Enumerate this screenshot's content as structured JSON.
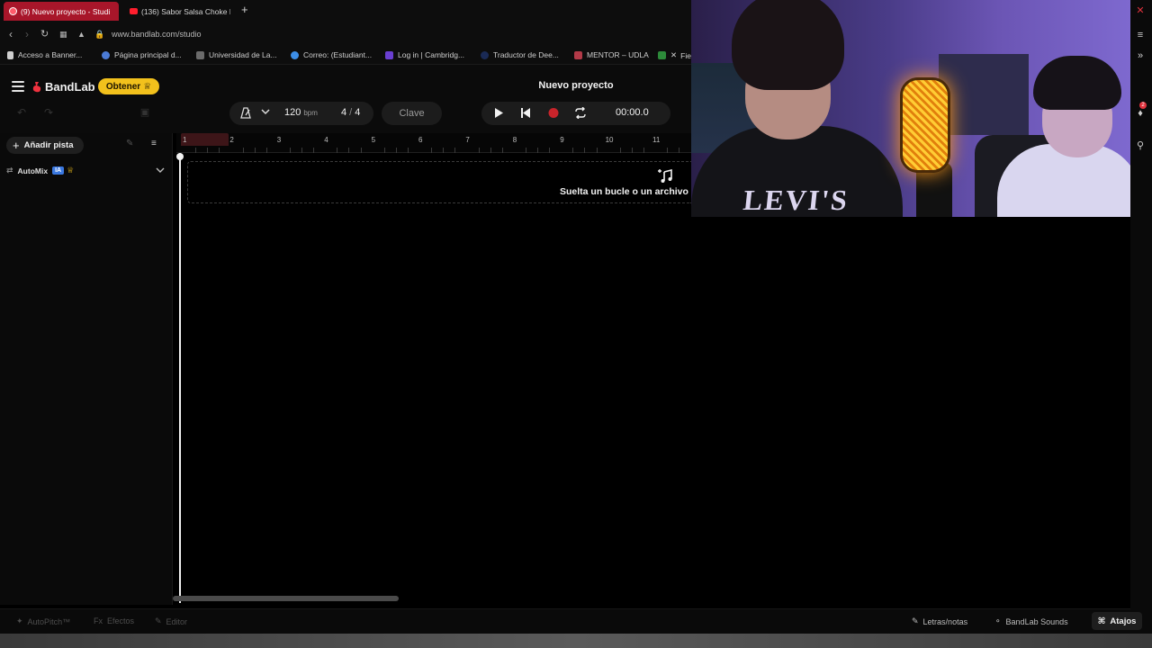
{
  "browser": {
    "tabs": [
      {
        "label": "(9) Nuevo proyecto - Studi",
        "active": true
      },
      {
        "label": "(136) Sabor Salsa Choke I",
        "active": false
      }
    ],
    "new_tab": "+",
    "url": "www.bandlab.com/studio",
    "bookmarks": [
      {
        "label": "Acceso a Banner...",
        "color": "#cfcfcf"
      },
      {
        "label": "Página principal d...",
        "color": "#4b7bd6"
      },
      {
        "label": "Universidad de La...",
        "color": "#6b6b6b"
      },
      {
        "label": "Correo: (Estudiant...",
        "color": "#3c8ee8"
      },
      {
        "label": "Log in | Cambridg...",
        "color": "#6a3fd1"
      },
      {
        "label": "Traductor de Dee...",
        "color": "#1a2a55"
      },
      {
        "label": "MENTOR – UDLA",
        "color": "#b23a48"
      },
      {
        "label": "Fie",
        "color": "#2d8a3a"
      }
    ]
  },
  "app": {
    "brand": "BandLab",
    "obtener_label": "Obtener",
    "project_title": "Nuevo proyecto",
    "tempo_value": "120",
    "tempo_unit": "bpm",
    "sig_num": "4",
    "sig_sep": "/",
    "sig_den": "4",
    "key_label": "Clave",
    "time": "00:00.0",
    "accent": "#f2c11c",
    "record_color": "#c8242b"
  },
  "sidebar": {
    "add_track": "Añadir pista",
    "automix": "AutoMix",
    "ia_badge": "IA"
  },
  "timeline": {
    "bars": [
      "1",
      "2",
      "3",
      "4",
      "5",
      "6",
      "7",
      "8",
      "9",
      "10",
      "11"
    ],
    "drop_text": "Suelta un bucle o un archivo de audio"
  },
  "bottom": {
    "autopitch": "AutoPitch™",
    "efectos": "Efectos",
    "efectos_icon": "Fx",
    "editor": "Editor",
    "letras": "Letras/notas",
    "sounds": "BandLab Sounds",
    "atajos": "Atajos"
  },
  "webcam": {
    "shirt_text": "LEVI'S"
  },
  "notifications": {
    "count": "2"
  }
}
